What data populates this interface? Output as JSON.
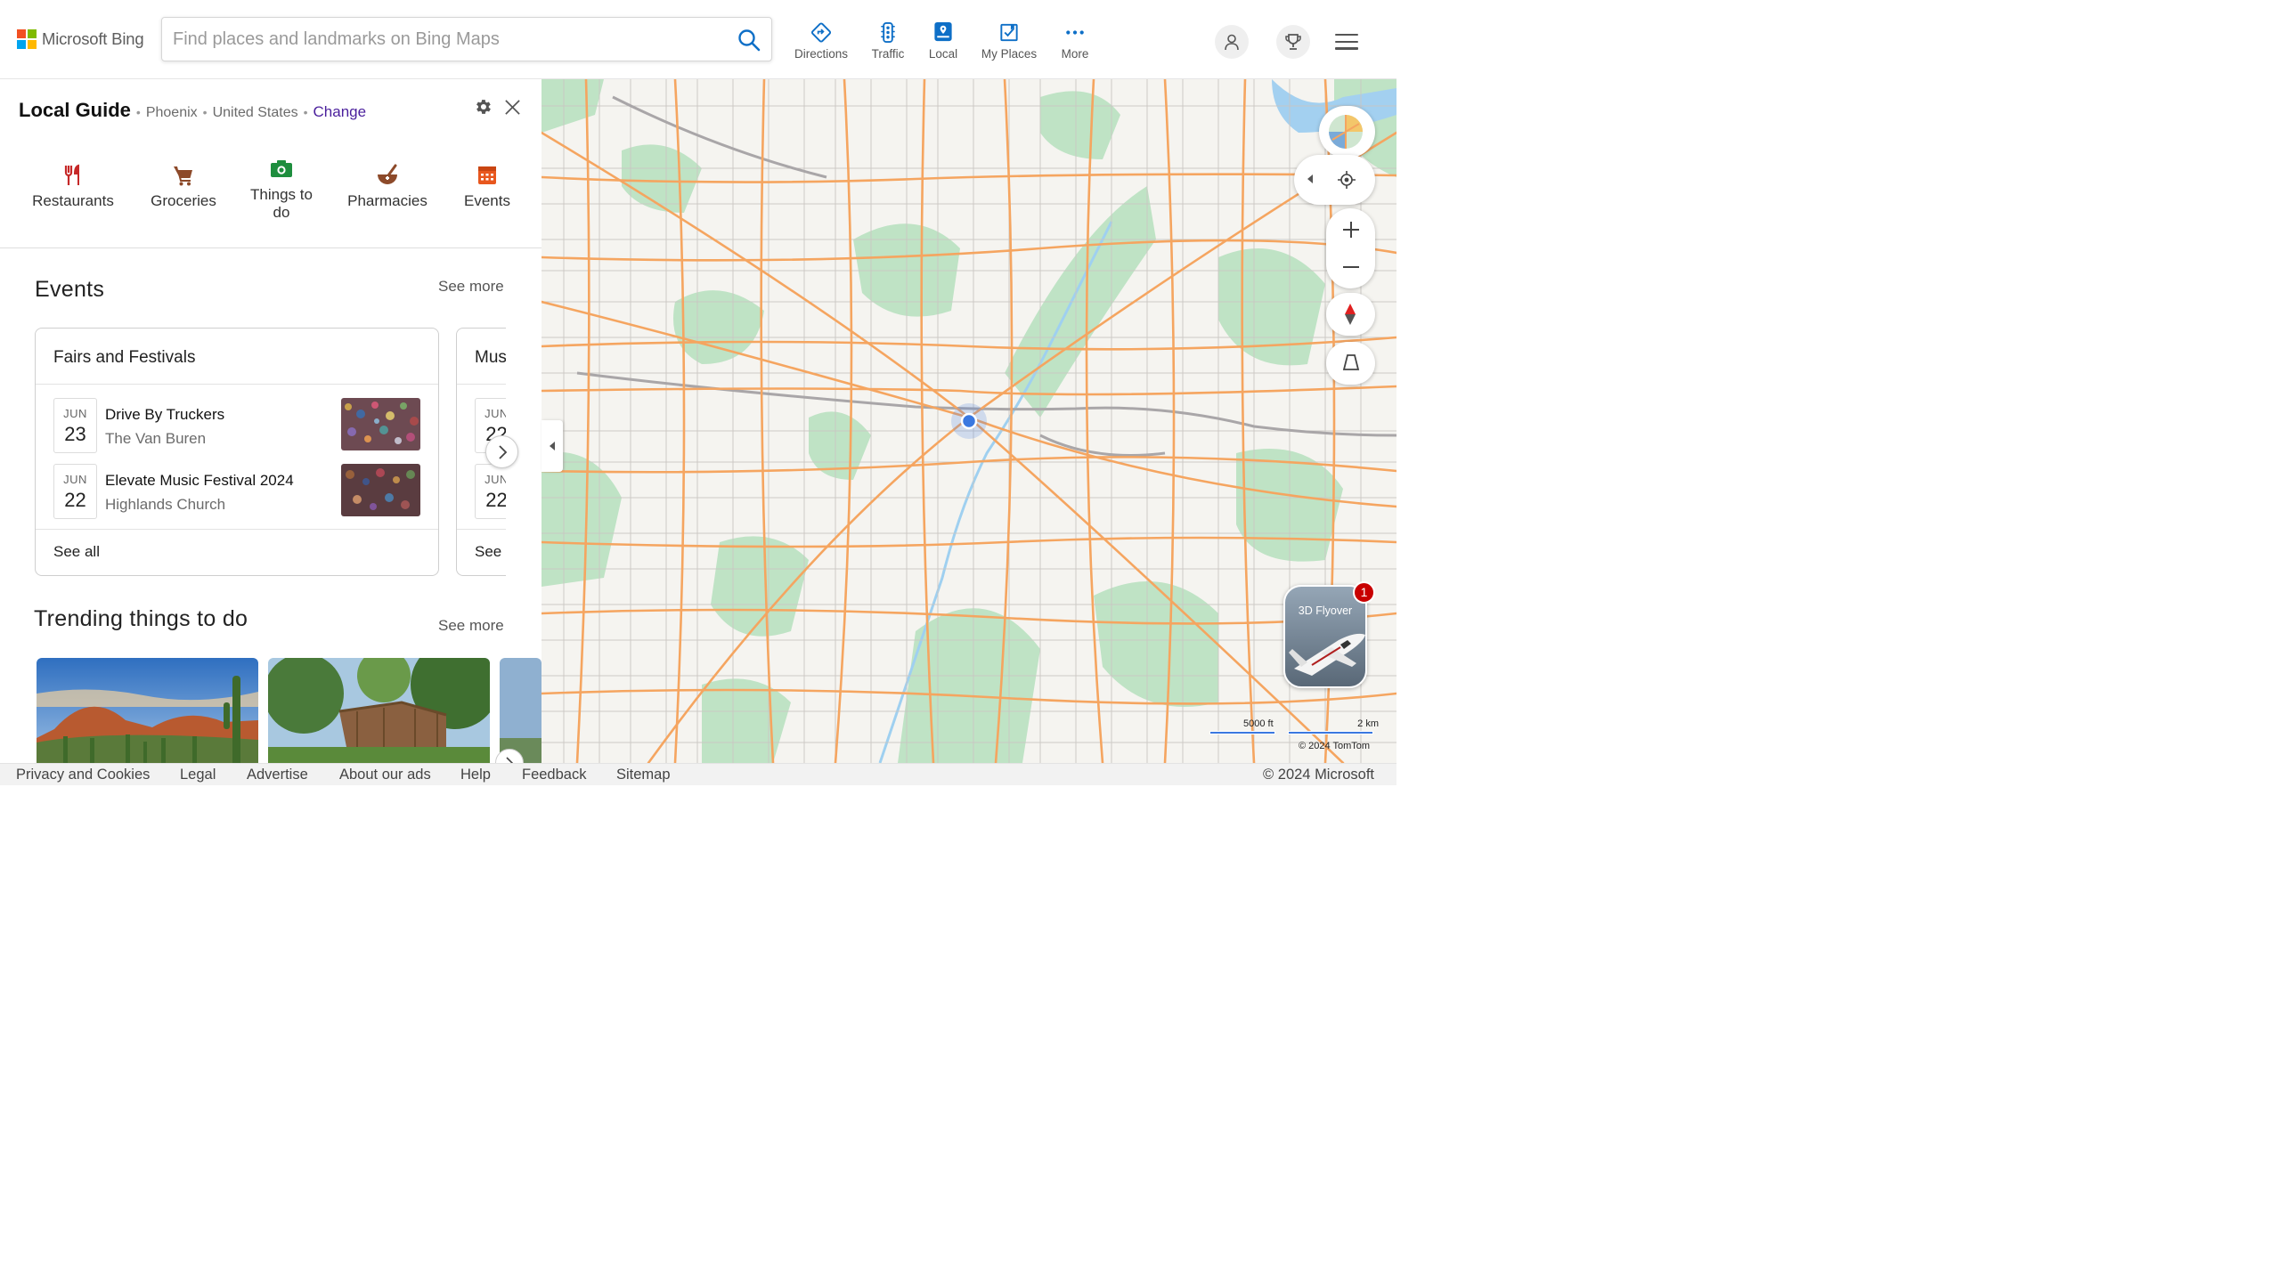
{
  "header": {
    "logo_text": "Microsoft Bing",
    "search_placeholder": "Find places and landmarks on Bing Maps",
    "nav": [
      {
        "label": "Directions",
        "icon": "directions-icon"
      },
      {
        "label": "Traffic",
        "icon": "traffic-icon"
      },
      {
        "label": "Local",
        "icon": "local-icon"
      },
      {
        "label": "My Places",
        "icon": "my-places-icon"
      },
      {
        "label": "More",
        "icon": "more-icon"
      }
    ],
    "colors": {
      "accent": "#0078d4",
      "logo_red": "#f25022",
      "logo_green": "#7fba00",
      "logo_blue": "#00a4ef",
      "logo_yellow": "#ffb900"
    }
  },
  "local_guide": {
    "title": "Local Guide",
    "city": "Phoenix",
    "country": "United States",
    "change_label": "Change",
    "categories": [
      {
        "label": "Restaurants",
        "icon": "restaurant-icon",
        "color": "#c62828"
      },
      {
        "label": "Groceries",
        "icon": "cart-icon",
        "color": "#8d4a2a"
      },
      {
        "label": "Things to do",
        "icon": "camera-icon",
        "color": "#1e8e3e"
      },
      {
        "label": "Pharmacies",
        "icon": "mortar-pestle-icon",
        "color": "#8d4a2a"
      },
      {
        "label": "Events",
        "icon": "calendar-icon",
        "color": "#e8571e"
      }
    ]
  },
  "events": {
    "title": "Events",
    "see_more": "See more",
    "cards": [
      {
        "heading": "Fairs and Festivals",
        "items": [
          {
            "month": "JUN",
            "day": "23",
            "name": "Drive By Truckers",
            "venue": "The Van Buren"
          },
          {
            "month": "JUN",
            "day": "22",
            "name": "Elevate Music Festival 2024",
            "venue": "Highlands Church"
          }
        ],
        "see_all": "See all"
      },
      {
        "heading": "Mus",
        "items": [
          {
            "month": "JUN",
            "day": "22"
          },
          {
            "month": "JUN",
            "day": "22"
          }
        ],
        "see_all": "See"
      }
    ]
  },
  "trending": {
    "title": "Trending things to do",
    "see_more": "See more"
  },
  "map": {
    "flyover_label": "3D Flyover",
    "flyover_badge": "1",
    "scale_ft": "5000 ft",
    "scale_km": "2 km",
    "copyright": "© 2024 TomTom"
  },
  "footer": {
    "links": [
      "Privacy and Cookies",
      "Legal",
      "Advertise",
      "About our ads",
      "Help",
      "Feedback",
      "Sitemap"
    ],
    "copyright": "© 2024 Microsoft"
  }
}
